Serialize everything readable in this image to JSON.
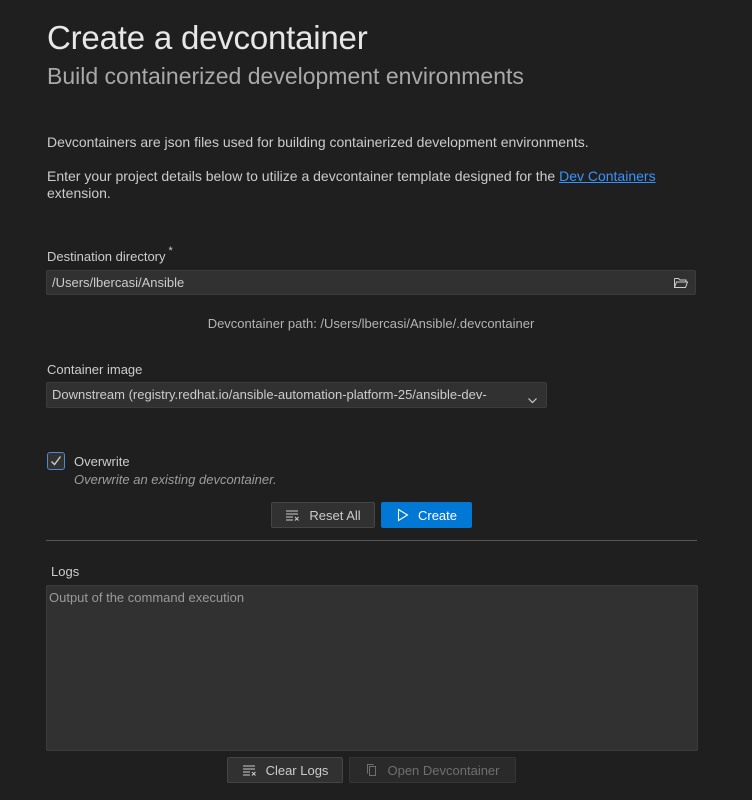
{
  "header": {
    "title": "Create a devcontainer",
    "subtitle": "Build containerized development environments"
  },
  "intro": {
    "line1": "Devcontainers are json files used for building containerized development environments.",
    "line2_prefix": "Enter your project details below to utilize a devcontainer template designed for the ",
    "line2_link": "Dev Containers",
    "line2_suffix": "extension."
  },
  "destination": {
    "label": "Destination directory",
    "required_marker": "*",
    "value": "/Users/lbercasi/Ansible",
    "icon": "folder-open-icon",
    "path_hint": "Devcontainer path: /Users/lbercasi/Ansible/.devcontainer"
  },
  "container_image": {
    "label": "Container image",
    "selected": "Downstream (registry.redhat.io/ansible-automation-platform-25/ansible-dev-",
    "icon": "chevron-down-icon"
  },
  "overwrite": {
    "label": "Overwrite",
    "description": "Overwrite an existing devcontainer.",
    "checked": true
  },
  "actions": {
    "reset_label": "Reset All",
    "create_label": "Create",
    "reset_icon": "clear-all-icon",
    "create_icon": "run-icon"
  },
  "logs": {
    "label": "Logs",
    "placeholder": "Output of the command execution",
    "clear_label": "Clear Logs",
    "open_label": "Open Devcontainer",
    "clear_icon": "clear-all-icon",
    "open_icon": "file-copy-icon"
  },
  "colors": {
    "background": "#1f1f1f",
    "accent": "#0078d4",
    "link": "#3794ff"
  }
}
